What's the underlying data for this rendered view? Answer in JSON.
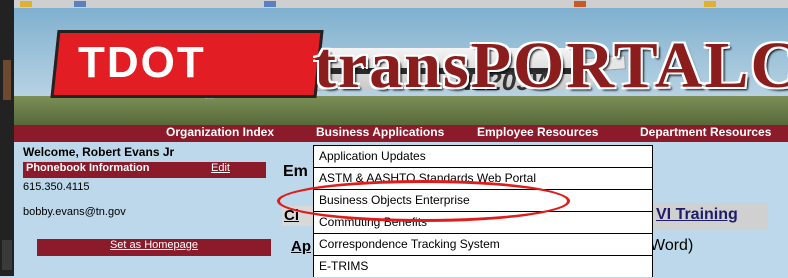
{
  "banner": {
    "logo_text": "TDOT",
    "site_title": "transPORTAL",
    "site_title_cut": "C",
    "plane_registration": "N2209W"
  },
  "nav": {
    "items": [
      {
        "label": "Organization Index"
      },
      {
        "label": "Business Applications"
      },
      {
        "label": "Employee Resources"
      },
      {
        "label": "Department Resources"
      }
    ]
  },
  "user": {
    "welcome": "Welcome,  Robert Evans Jr",
    "phonebook_label": "Phonebook Information",
    "edit_label": "Edit",
    "phone": "615.350.4115",
    "email": "bobby.evans@tn.gov",
    "homepage_button": "Set as Homepage"
  },
  "main": {
    "heading_partial": "Em",
    "link_partial": "Ci",
    "training_link": "VI Training",
    "ap_partial": "Ap",
    "word_text": "Word)"
  },
  "dropdown": {
    "items": [
      {
        "label": "Application Updates"
      },
      {
        "label": "ASTM & AASHTO Standards Web Portal"
      },
      {
        "label": "Business Objects Enterprise"
      },
      {
        "label": "Commuting Benefits"
      },
      {
        "label": "Correspondence Tracking System"
      },
      {
        "label": "E-TRIMS"
      }
    ]
  },
  "colors": {
    "nav_bar": "#8b1a2a",
    "page_bg": "#bcd8ea",
    "highlight_ellipse": "#e01b1b"
  }
}
